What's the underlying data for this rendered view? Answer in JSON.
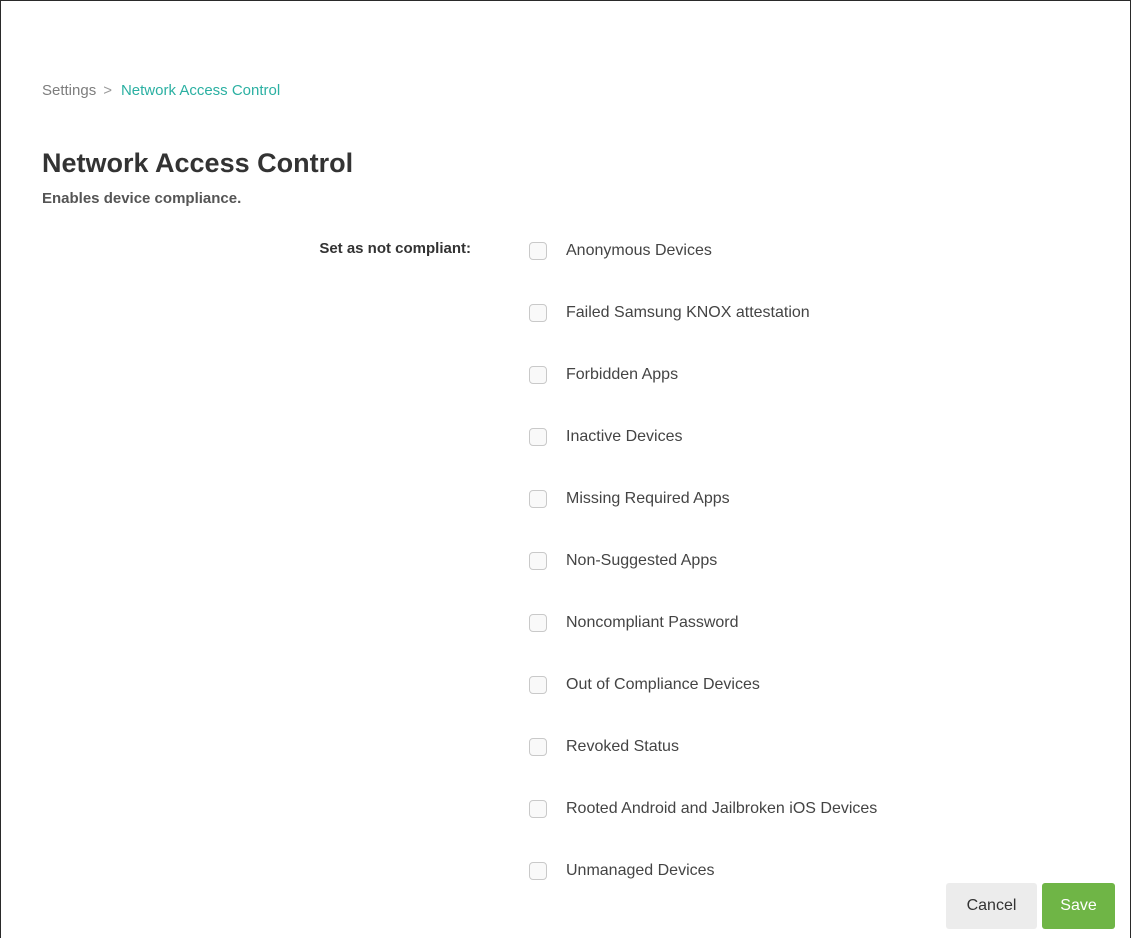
{
  "breadcrumb": {
    "parent": "Settings",
    "separator": ">",
    "current": "Network Access Control"
  },
  "page": {
    "title": "Network Access Control",
    "subtitle": "Enables device compliance."
  },
  "compliance": {
    "label": "Set as not compliant:",
    "options": [
      {
        "label": "Anonymous Devices",
        "checked": false
      },
      {
        "label": "Failed Samsung KNOX attestation",
        "checked": false
      },
      {
        "label": "Forbidden Apps",
        "checked": false
      },
      {
        "label": "Inactive Devices",
        "checked": false
      },
      {
        "label": "Missing Required Apps",
        "checked": false
      },
      {
        "label": "Non-Suggested Apps",
        "checked": false
      },
      {
        "label": "Noncompliant Password",
        "checked": false
      },
      {
        "label": "Out of Compliance Devices",
        "checked": false
      },
      {
        "label": "Revoked Status",
        "checked": false
      },
      {
        "label": "Rooted Android and Jailbroken iOS Devices",
        "checked": false
      },
      {
        "label": "Unmanaged Devices",
        "checked": false
      }
    ]
  },
  "actions": {
    "cancel_label": "Cancel",
    "save_label": "Save"
  },
  "colors": {
    "breadcrumb_current": "#2bb0a2",
    "save_button": "#6fb546",
    "cancel_button": "#ececec"
  }
}
